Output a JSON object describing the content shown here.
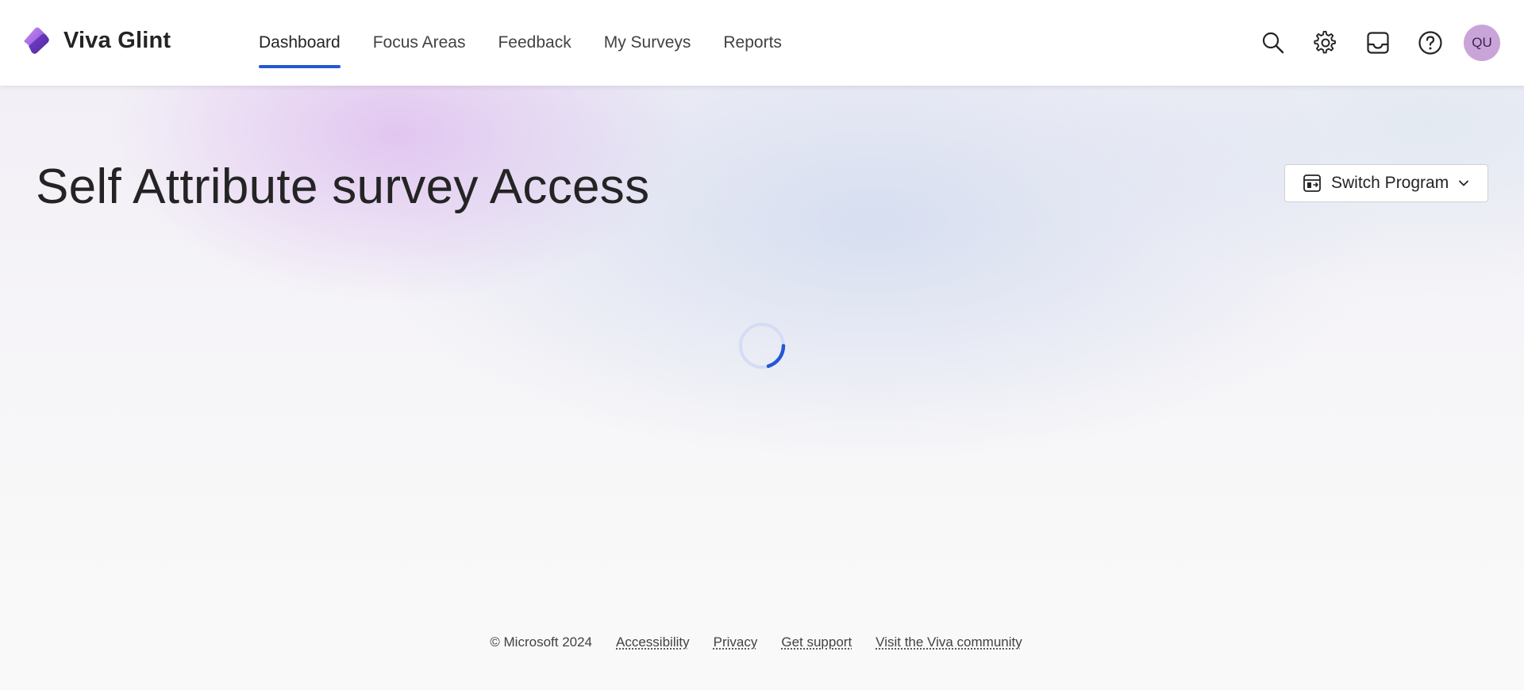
{
  "app": {
    "name": "Viva Glint",
    "logo_icon": "viva-glint-logo"
  },
  "nav": {
    "items": [
      {
        "label": "Dashboard",
        "active": true
      },
      {
        "label": "Focus Areas",
        "active": false
      },
      {
        "label": "Feedback",
        "active": false
      },
      {
        "label": "My Surveys",
        "active": false
      },
      {
        "label": "Reports",
        "active": false
      }
    ],
    "active_color": "#2557d6"
  },
  "toolbar": {
    "icons": [
      "search-icon",
      "gear-icon",
      "inbox-icon",
      "help-icon"
    ],
    "avatar_initials": "QU",
    "avatar_color": "#c9a4d9"
  },
  "main": {
    "title": "Self Attribute survey Access",
    "switch_program_label": "Switch Program",
    "loading": true,
    "spinner_color": "#2557d6"
  },
  "footer": {
    "copyright": "© Microsoft 2024",
    "links": [
      "Accessibility",
      "Privacy",
      "Get support",
      "Visit the Viva community"
    ]
  }
}
